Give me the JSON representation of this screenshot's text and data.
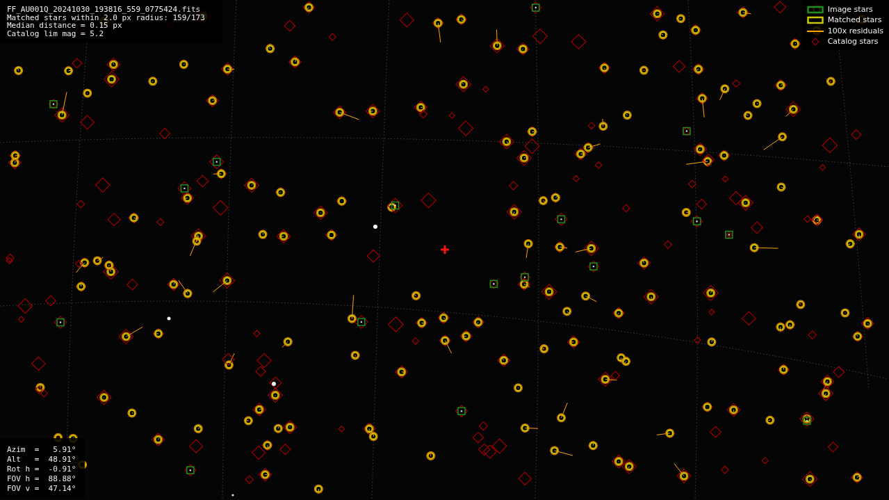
{
  "info_lines": [
    "FF_AU001Q_20241030_193816_559_0775424.fits",
    "Matched stars within 2.0 px radius: 159/173",
    "Median distance = 0.15 px",
    "Catalog lim mag = 5.2"
  ],
  "legend": [
    {
      "kind": "image",
      "label": "Image stars",
      "color": "#1e8c1e"
    },
    {
      "kind": "matched",
      "label": "Matched stars",
      "color": "#c8c800"
    },
    {
      "kind": "residual",
      "label": "100x residuals",
      "color": "#ffa500"
    },
    {
      "kind": "catalog",
      "label": "Catalog stars",
      "color": "#a00000"
    }
  ],
  "pointing": [
    "Azim  =   5.91°",
    "Alt   =  48.91°",
    "Rot h =  -0.91°",
    "FOV h =  88.88°",
    "FOV v =  47.14°"
  ]
}
